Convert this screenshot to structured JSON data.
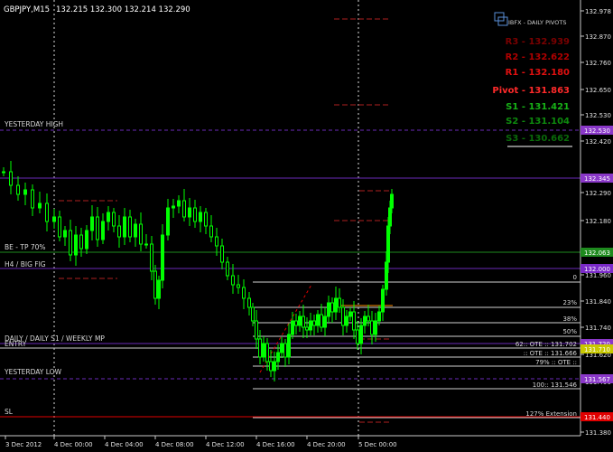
{
  "header": {
    "symbol": "GBPJPY,M15",
    "ohlc": "132.215 132.300 132.214 132.290"
  },
  "pivot_panel": {
    "title": "IBFX - DAILY PIVOTS",
    "items": [
      {
        "text": "R3 - 132.939",
        "color": "#7a0000"
      },
      {
        "text": "R2 - 132.622",
        "color": "#b00000"
      },
      {
        "text": "R1 - 132.180",
        "color": "#e01010"
      },
      {
        "text": "Pivot - 131.863",
        "color": "#ff2a2a"
      },
      {
        "text": "S1 - 131.421",
        "color": "#17b017"
      },
      {
        "text": "S2 - 131.104",
        "color": "#0e8a0e"
      },
      {
        "text": "S3 - 130.662",
        "color": "#0a6a0a"
      }
    ]
  },
  "price_axis": {
    "ticks": [
      "132.978",
      "132.870",
      "132.760",
      "132.650",
      "132.530",
      "132.420",
      "132.290",
      "132.180",
      "131.960",
      "131.840",
      "131.740",
      "131.620",
      "131.490",
      "131.380"
    ],
    "current_price": "132.290"
  },
  "level_badges": [
    {
      "text": "132.530",
      "color": "#8a38c8",
      "price": 132.53
    },
    {
      "text": "132.345",
      "color": "#8a38c8",
      "price": 132.345
    },
    {
      "text": "132.063",
      "color": "#1e8a1e",
      "price": 132.063
    },
    {
      "text": "132.000",
      "color": "#7a2ac8",
      "price": 132.0
    },
    {
      "text": "131.720",
      "color": "#8a38c8",
      "price": 131.72
    },
    {
      "text": "131.710",
      "color": "#c8c800",
      "price": 131.705
    },
    {
      "text": "131.567",
      "color": "#8a38c8",
      "price": 131.567
    },
    {
      "text": "131.440",
      "color": "#e00000",
      "price": 131.44
    }
  ],
  "line_labels": {
    "yesterday_high": "YESTERDAY HIGH",
    "be_tp": "BE - TP 70%",
    "h4_big_fig": "H4 / BIG FIG",
    "daily_s1": "DAILY / DAILY S1 / WEEKLY MP",
    "entry": "ENTRY",
    "yesterday_low": "YESTERDAY LOW",
    "sl": "SL"
  },
  "fib_labels": {
    "zero": "0",
    "p23": "23%",
    "p38": "38%",
    "p50": "50%",
    "ote62": "62:: OTE :: 131.702",
    "ote_b": ":: OTE :: 131.666",
    "p79": "79% :: OTE ::",
    "p100": "100:: 131.546",
    "ext127": "127% Extension"
  },
  "time_axis": [
    "3 Dec 2012",
    "4 Dec 00:00",
    "4 Dec 04:00",
    "4 Dec 08:00",
    "4 Dec 12:00",
    "4 Dec 16:00",
    "4 Dec 20:00",
    "5 Dec 00:00"
  ],
  "colors": {
    "candle": "#00ff00",
    "purple_line": "#6a2ab8",
    "green_line": "#1e8a1e",
    "red_line": "#e00000",
    "fib_line": "#d0d0d0",
    "orange_line": "#ff8c00",
    "pivot_dash": "#8b1a1a"
  }
}
